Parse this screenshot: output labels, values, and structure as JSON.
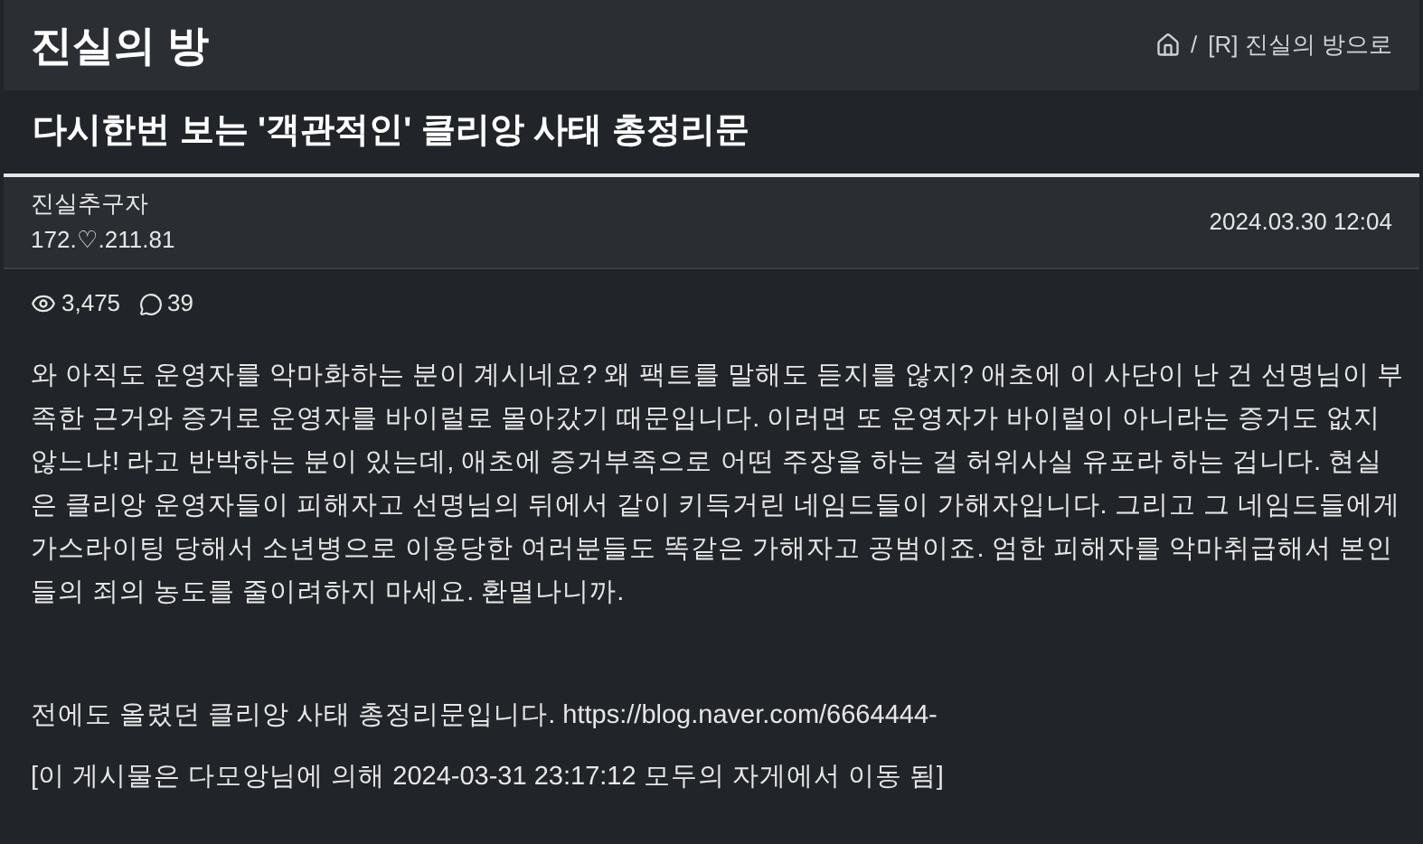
{
  "board": {
    "title": "진실의 방",
    "breadcrumb": "[R] 진실의 방으로",
    "breadcrumb_separator": "/"
  },
  "post": {
    "title": "다시한번 보는 '객관적인' 클리앙 사태 총정리문",
    "author": "진실추구자",
    "ip": "172.♡.211.81",
    "date": "2024.03.30 12:04",
    "views": "3,475",
    "comments": "39",
    "paragraphs": [
      "와 아직도 운영자를 악마화하는 분이 계시네요? 왜 팩트를 말해도 듣지를 않지? 애초에 이 사단이 난 건 선명님이 부족한 근거와 증거로 운영자를 바이럴로 몰아갔기 때문입니다. 이러면 또 운영자가 바이럴이 아니라는 증거도 없지 않느냐! 라고 반박하는 분이 있는데, 애초에 증거부족으로 어떤 주장을 하는 걸 허위사실 유포라 하는 겁니다. 현실은 클리앙 운영자들이 피해자고 선명님의 뒤에서 같이 키득거린 네임드들이 가해자입니다. 그리고 그 네임드들에게 가스라이팅 당해서 소년병으로 이용당한 여러분들도 똑같은 가해자고 공범이죠. 엄한 피해자를 악마취급해서 본인들의 죄의 농도를 줄이려하지 마세요. 환멸나니까.",
      "전에도 올렸던 클리앙 사태 총정리문입니다. https://blog.naver.com/6664444-",
      "[이 게시물은 다모앙님에 의해 2024-03-31 23:17:12 모두의 자게에서 이동 됨]"
    ]
  }
}
